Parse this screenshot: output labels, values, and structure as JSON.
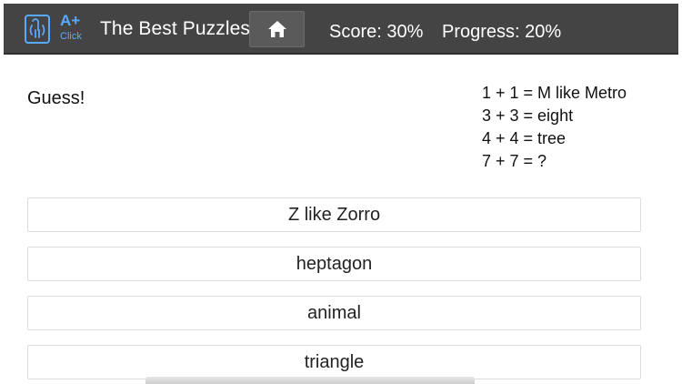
{
  "header": {
    "logo_aplus": "A+",
    "logo_click": "Click",
    "title": "The Best Puzzles",
    "home_icon": "home-icon",
    "score": "Score: 30%",
    "progress": "Progress: 20%",
    "bar_color": "#444444",
    "accent": "#5aa9ff"
  },
  "question": {
    "label": "Guess!",
    "lines": [
      "1 + 1 =  M  like  Metro",
      "3 + 3  = eight",
      "4 + 4  = tree",
      "7 + 7 =   ?"
    ]
  },
  "answers": [
    "Z like Zorro",
    "heptagon",
    "animal",
    "triangle"
  ]
}
